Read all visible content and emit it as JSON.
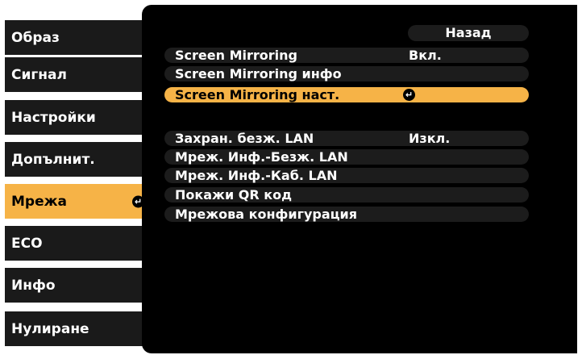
{
  "sidebar": {
    "items": [
      {
        "label": "Образ"
      },
      {
        "label": "Сигнал"
      },
      {
        "label": "Настройки"
      },
      {
        "label": "Допълнит."
      },
      {
        "label": "Мрежа"
      },
      {
        "label": "ECO"
      },
      {
        "label": "Инфо"
      },
      {
        "label": "Нулиране"
      }
    ],
    "selected_index": 4
  },
  "main": {
    "back_label": "Назад",
    "rows": [
      {
        "label": "Screen Mirroring",
        "value": "Вкл."
      },
      {
        "label": "Screen Mirroring инфо",
        "value": ""
      },
      {
        "label": "Screen Mirroring наст.",
        "value": ""
      },
      {
        "label": "Захран. безж. LAN",
        "value": "Изкл."
      },
      {
        "label": "Мреж. Инф.-Безж. LAN",
        "value": ""
      },
      {
        "label": "Мреж. Инф.-Каб. LAN",
        "value": ""
      },
      {
        "label": "Покажи QR код",
        "value": ""
      },
      {
        "label": "Мрежова конфигурация",
        "value": ""
      }
    ],
    "highlighted_index": 2
  },
  "icons": {
    "enter": "enter-icon"
  },
  "colors": {
    "highlight": "#f6b347",
    "item_background": "#1a1a1a",
    "panel_background": "#000000",
    "text": "#ffffff"
  }
}
